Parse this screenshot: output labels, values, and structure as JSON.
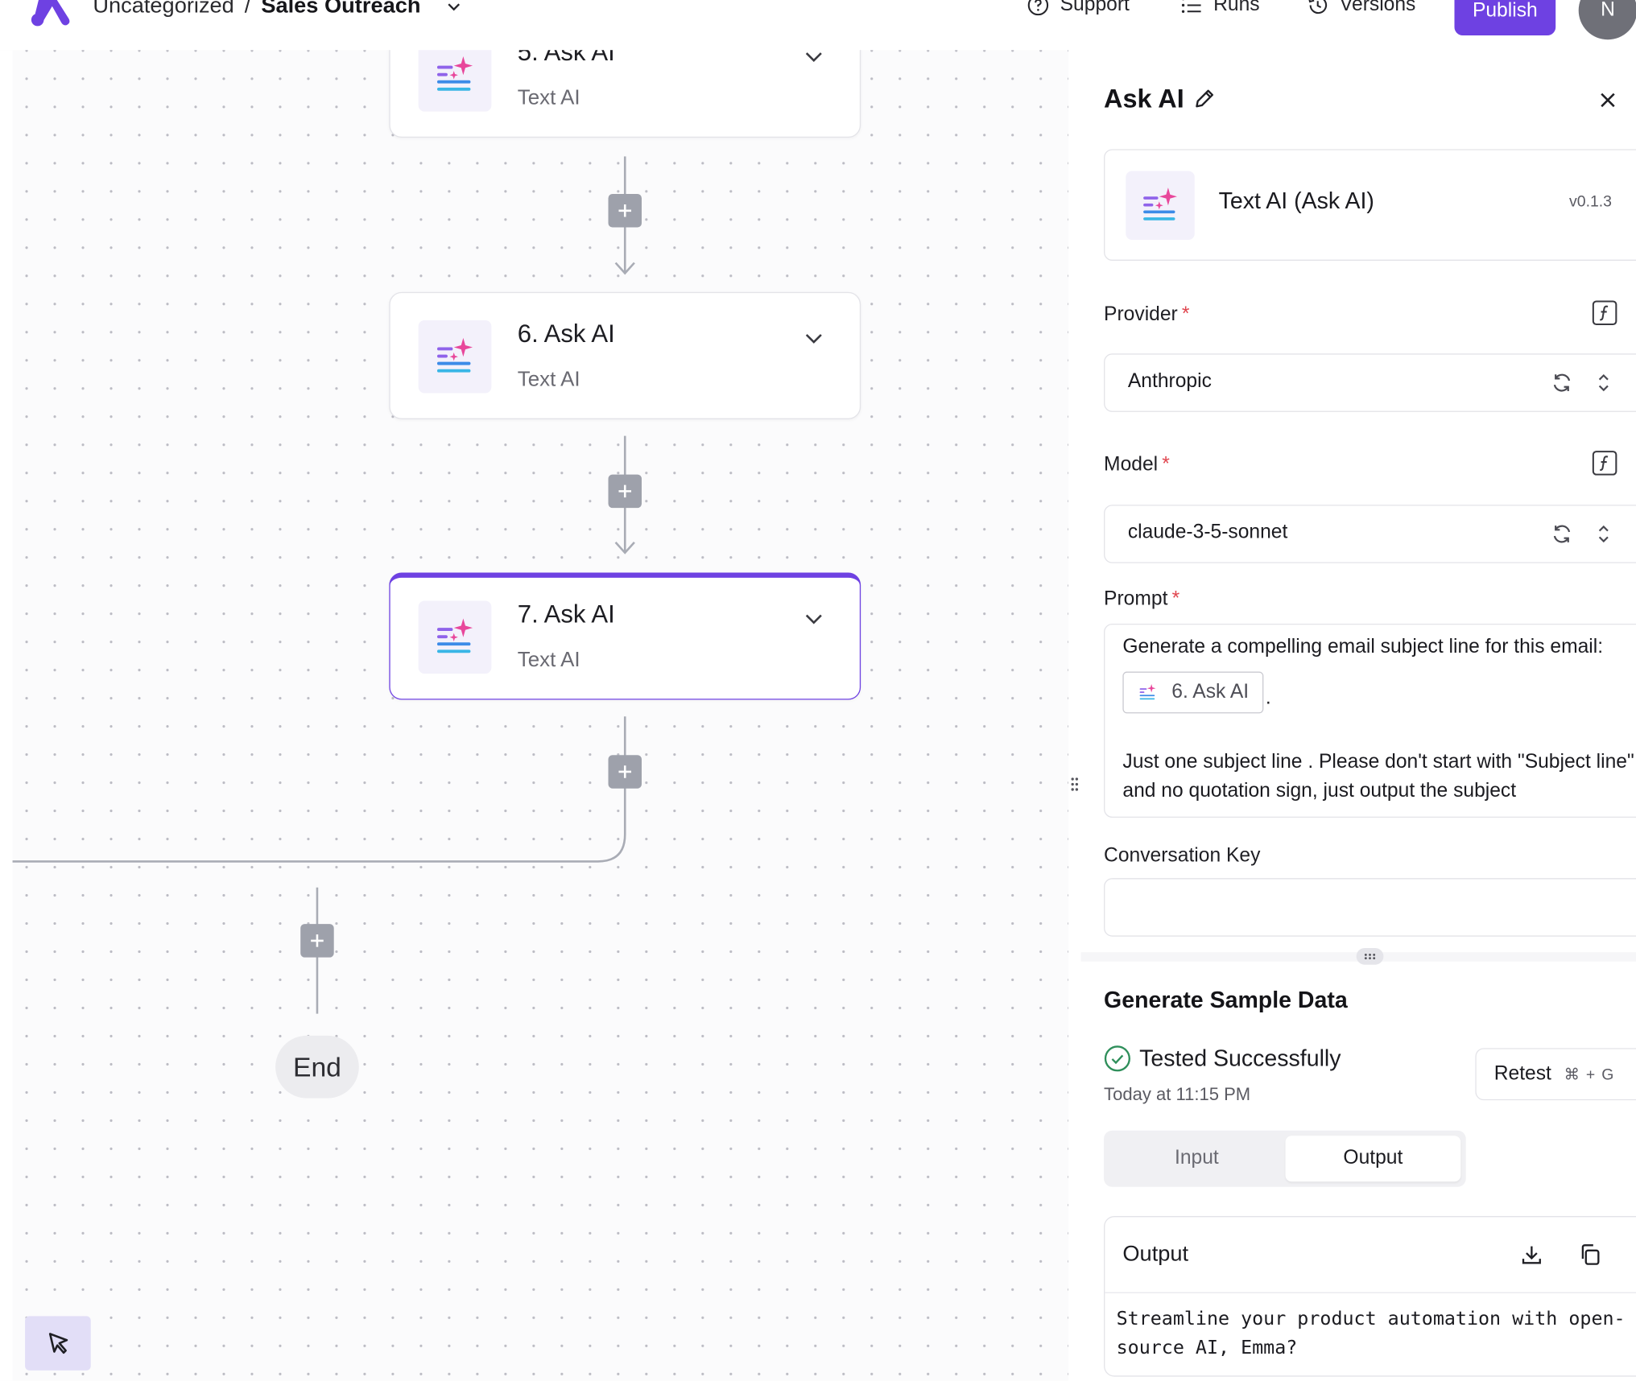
{
  "header": {
    "breadcrumb_folder": "Uncategorized",
    "breadcrumb_separator": "/",
    "breadcrumb_flow": "Sales Outreach",
    "nav_support": "Support",
    "nav_runs": "Runs",
    "nav_versions": "Versions",
    "publish_label": "Publish",
    "avatar_initial": "N"
  },
  "canvas": {
    "steps": [
      {
        "title": "5. Ask AI",
        "subtitle": "Text AI"
      },
      {
        "title": "6. Ask AI",
        "subtitle": "Text AI"
      },
      {
        "title": "7. Ask AI",
        "subtitle": "Text AI",
        "selected": true
      }
    ],
    "end_label": "End"
  },
  "panel": {
    "title": "Ask AI",
    "piece_name": "Text AI (Ask AI)",
    "piece_version": "v0.1.3",
    "provider_label": "Provider",
    "provider_value": "Anthropic",
    "model_label": "Model",
    "model_value": "claude-3-5-sonnet",
    "required_mark": "*",
    "prompt_label": "Prompt",
    "prompt_line1": "Generate a compelling email subject line for this email:",
    "prompt_chip": "6. Ask AI",
    "prompt_chip_suffix": ".",
    "prompt_line2": "Just one subject line . Please don't start with \"Subject line\" and no quotation sign, just output the subject",
    "conversation_key_label": "Conversation Key",
    "conversation_key_value": "",
    "sample": {
      "title": "Generate Sample Data",
      "status": "Tested Successfully",
      "tested_at": "Today at 11:15 PM",
      "retest_label": "Retest",
      "retest_shortcut": "⌘ + G",
      "tab_input": "Input",
      "tab_output": "Output",
      "output_title": "Output",
      "output_text": "Streamline your product automation with open-source AI, Emma?"
    }
  },
  "colors": {
    "accent": "#6e41e2",
    "success": "#2f8f5b",
    "required": "#e0454e"
  }
}
